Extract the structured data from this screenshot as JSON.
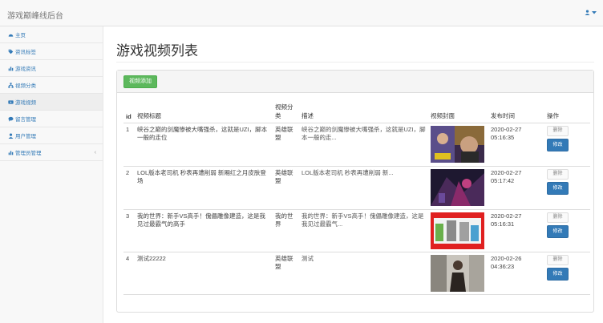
{
  "app": {
    "brand": "游戏巅峰线后台"
  },
  "sidebar": {
    "items": [
      {
        "label": "主页",
        "icon": "dashboard-icon"
      },
      {
        "label": "资讯标签",
        "icon": "tag-icon"
      },
      {
        "label": "游戏资讯",
        "icon": "bar-chart-icon"
      },
      {
        "label": "视频分类",
        "icon": "sitemap-icon"
      },
      {
        "label": "游戏视频",
        "icon": "video-icon"
      },
      {
        "label": "留言管理",
        "icon": "comments-icon"
      },
      {
        "label": "用户管理",
        "icon": "user-icon"
      },
      {
        "label": "管理员管理",
        "icon": "bar-chart-icon"
      }
    ],
    "active_index": 4
  },
  "page": {
    "title": "游戏视频列表",
    "add_button": "视频添加"
  },
  "table": {
    "headers": [
      "id",
      "视频标题",
      "视频分类",
      "描述",
      "视频封面",
      "发布时间",
      "操作"
    ],
    "rows": [
      {
        "id": "1",
        "title": "峡谷之巅的剑魔惨被大嘴强杀，这就是UZI，脚本一般的走位",
        "category": "英雄联盟",
        "desc": "峡谷之巅的剑魔惨被大嘴强杀，这就是UZI，脚本一般的走...",
        "date": "2020-02-27",
        "time": "05:16:35"
      },
      {
        "id": "2",
        "title": "LOL版本老司机 秒表再遭削弱 新厢红之月皮肤登场",
        "category": "英雄联盟",
        "desc": "LOL版本老司机 秒表再遭削弱 新...",
        "date": "2020-02-27",
        "time": "05:17:42"
      },
      {
        "id": "3",
        "title": "我的世界：新手VS高手！傀儡雕像建造，这是我见过最霸气的高手",
        "category": "我的世界",
        "desc": "我的世界：新手VS高手！傀儡雕像建造，这是我见过最霸气...",
        "date": "2020-02-27",
        "time": "05:16:31"
      },
      {
        "id": "4",
        "title": "测试22222",
        "category": "英雄联盟",
        "desc": "测试",
        "date": "2020-02-26",
        "time": "04:36:23"
      }
    ],
    "delete_label": "删除",
    "edit_label": "修改"
  },
  "colors": {
    "primary": "#337ab7",
    "success": "#5cb85c"
  }
}
